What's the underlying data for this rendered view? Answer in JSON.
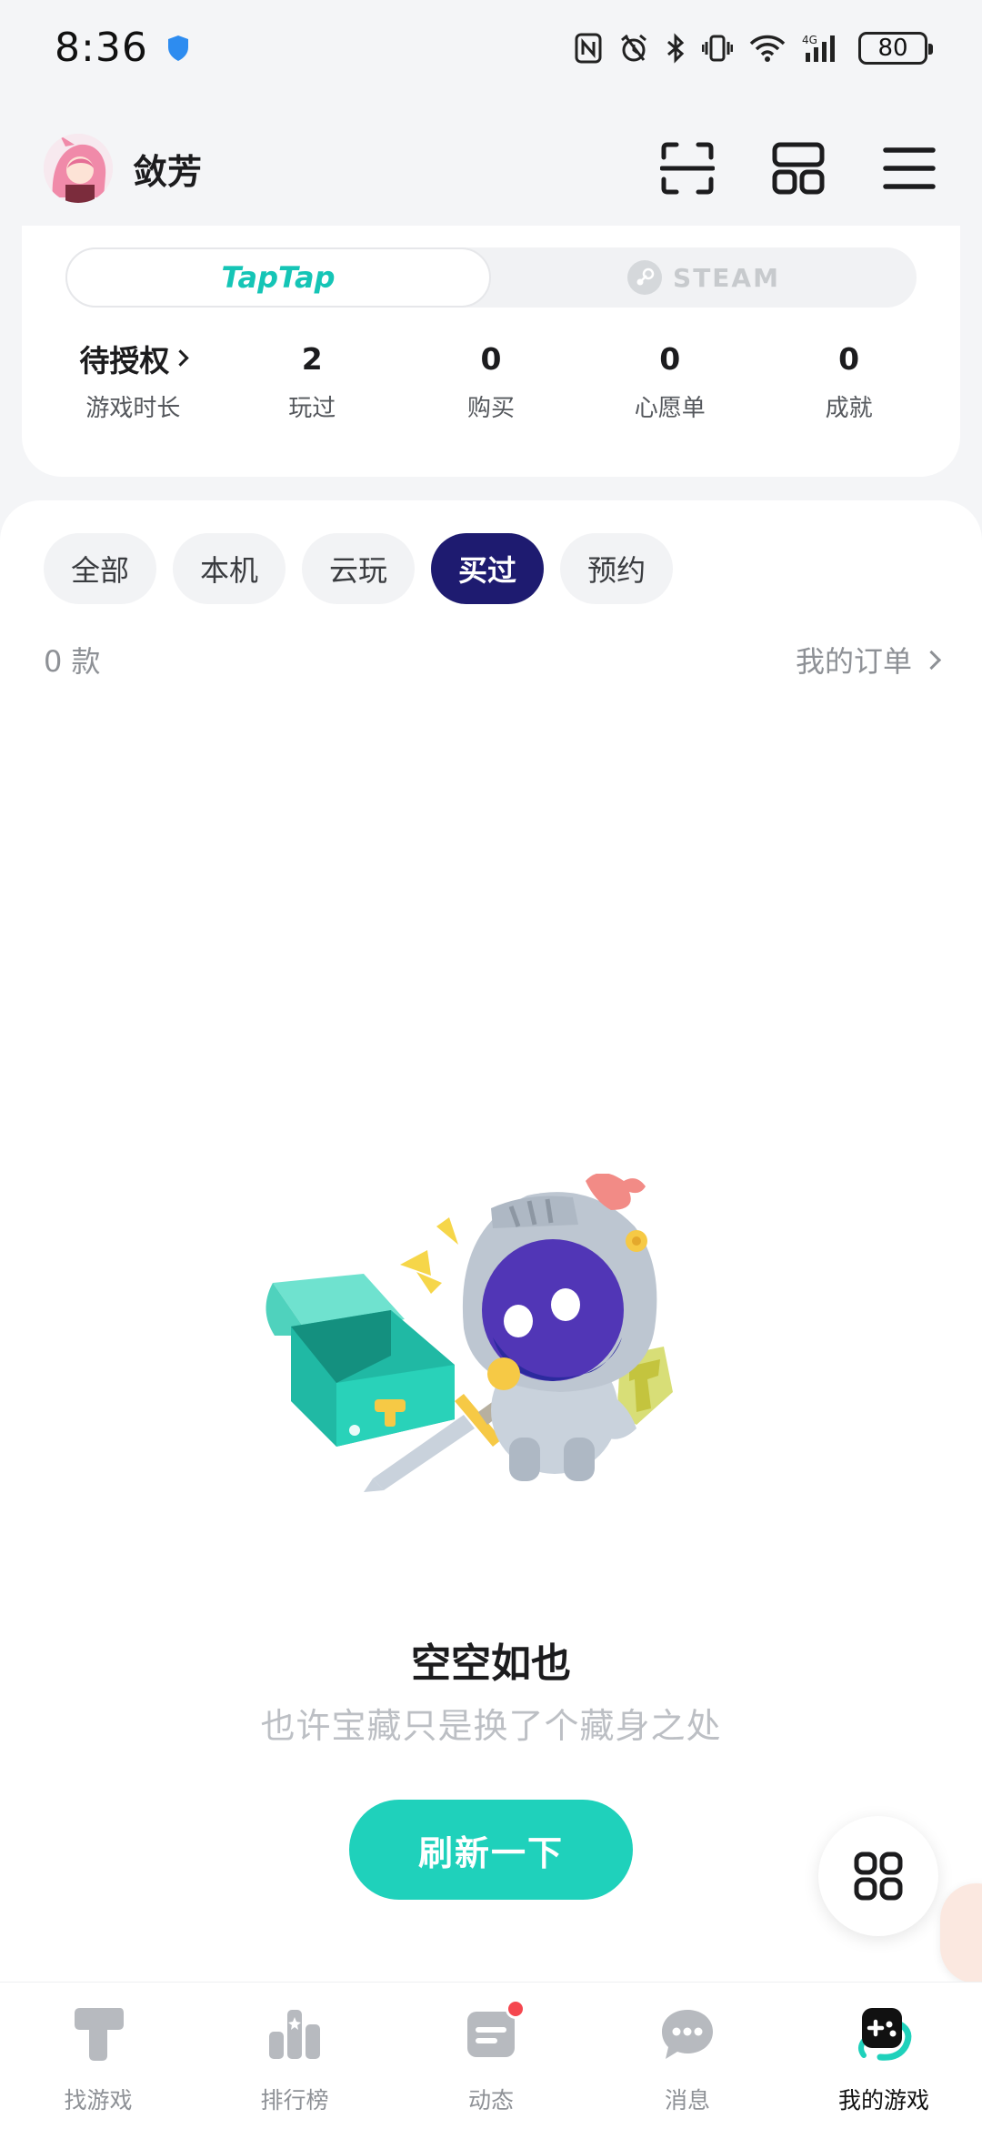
{
  "status_bar": {
    "time": "8:36",
    "battery": "80"
  },
  "header": {
    "username": "敛芳"
  },
  "platforms": {
    "tabs": [
      "TapTap",
      "STEAM"
    ],
    "active": "TapTap"
  },
  "stats": [
    {
      "value": "待授权",
      "label": "游戏时长"
    },
    {
      "value": "2",
      "label": "玩过"
    },
    {
      "value": "0",
      "label": "购买"
    },
    {
      "value": "0",
      "label": "心愿单"
    },
    {
      "value": "0",
      "label": "成就"
    }
  ],
  "filter_tabs": [
    "全部",
    "本机",
    "云玩",
    "买过",
    "预约"
  ],
  "active_filter": "买过",
  "list": {
    "count": "0 款",
    "orders_link": "我的订单"
  },
  "empty_state": {
    "title": "空空如也",
    "subtitle": "也许宝藏只是换了个藏身之处",
    "button": "刷新一下"
  },
  "bottom_nav": [
    {
      "label": "找游戏",
      "icon": "find-games-icon"
    },
    {
      "label": "排行榜",
      "icon": "ranking-icon"
    },
    {
      "label": "动态",
      "icon": "feed-icon",
      "badge": true
    },
    {
      "label": "消息",
      "icon": "message-icon"
    },
    {
      "label": "我的游戏",
      "icon": "my-games-icon",
      "active": true
    }
  ],
  "colors": {
    "accent": "#1fd1bb",
    "active_filter": "#1e1b70",
    "badge": "#f5474f"
  }
}
